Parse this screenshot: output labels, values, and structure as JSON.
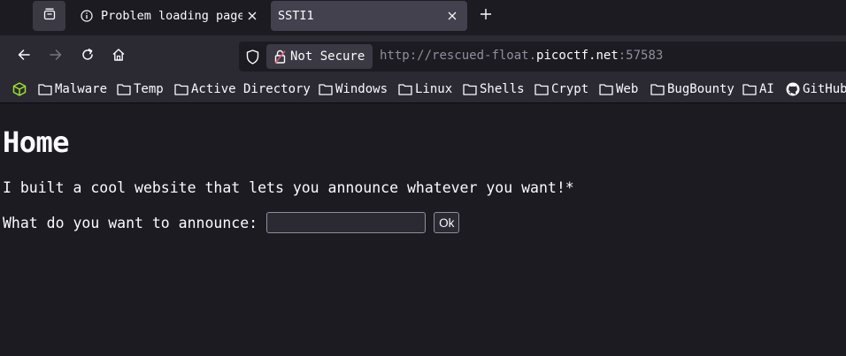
{
  "browser": {
    "tabs": [
      {
        "label": "Problem loading page",
        "icon": "info-icon",
        "active": false
      },
      {
        "label": "SSTI1",
        "icon": "none",
        "active": true
      }
    ],
    "address": {
      "security_label": "Not Secure",
      "url_scheme": "http://",
      "url_subdomain": "rescued-float.",
      "url_host": "picoctf.net",
      "url_port": ":57583"
    },
    "bookmarks": [
      {
        "label": "",
        "icon": "cube-icon"
      },
      {
        "label": "Malware",
        "icon": "folder-icon"
      },
      {
        "label": "Temp",
        "icon": "folder-icon"
      },
      {
        "label": "Active Directory",
        "icon": "folder-icon"
      },
      {
        "label": "Windows",
        "icon": "folder-icon"
      },
      {
        "label": "Linux",
        "icon": "folder-icon"
      },
      {
        "label": "Shells",
        "icon": "folder-icon"
      },
      {
        "label": "Crypt",
        "icon": "folder-icon"
      },
      {
        "label": "Web",
        "icon": "folder-icon"
      },
      {
        "label": "BugBounty",
        "icon": "folder-icon"
      },
      {
        "label": "AI",
        "icon": "folder-icon"
      },
      {
        "label": "GitHub",
        "icon": "github-icon"
      }
    ],
    "colors": {
      "tabstrip_bg": "#1c1b22",
      "toolbar_bg": "#2b2a33",
      "active_tab_bg": "#42414d",
      "cube_icon": "#9be22d",
      "lock_warning": "#e05576"
    }
  },
  "page": {
    "heading": "Home",
    "intro": "I built a cool website that lets you announce whatever you want!*",
    "form": {
      "label": "What do you want to announce:",
      "input_value": "",
      "submit_label": "Ok"
    }
  }
}
